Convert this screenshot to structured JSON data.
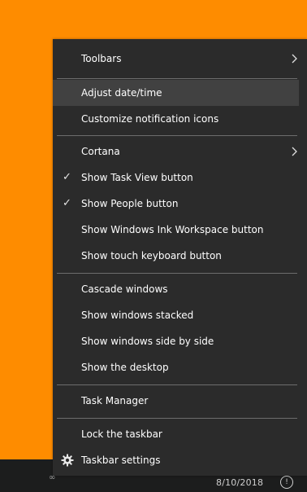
{
  "menu": {
    "items": [
      {
        "label": "Toolbars"
      },
      {
        "label": "Adjust date/time"
      },
      {
        "label": "Customize notification icons"
      },
      {
        "label": "Cortana"
      },
      {
        "label": "Show Task View button"
      },
      {
        "label": "Show People button"
      },
      {
        "label": "Show Windows Ink Workspace button"
      },
      {
        "label": "Show touch keyboard button"
      },
      {
        "label": "Cascade windows"
      },
      {
        "label": "Show windows stacked"
      },
      {
        "label": "Show windows side by side"
      },
      {
        "label": "Show the desktop"
      },
      {
        "label": "Task Manager"
      },
      {
        "label": "Lock the taskbar"
      },
      {
        "label": "Taskbar settings"
      }
    ],
    "check_glyph": "✓",
    "icons": [
      "chevron-right-icon",
      "checkmark-icon",
      "gear-icon"
    ]
  },
  "taskbar": {
    "date": "8/10/2018",
    "notification_glyph": "!"
  },
  "colors": {
    "desktop": "#fe8c00",
    "menu_bg": "#2b2b2b",
    "hover": "#414141",
    "taskbar": "#1c1d1d"
  }
}
